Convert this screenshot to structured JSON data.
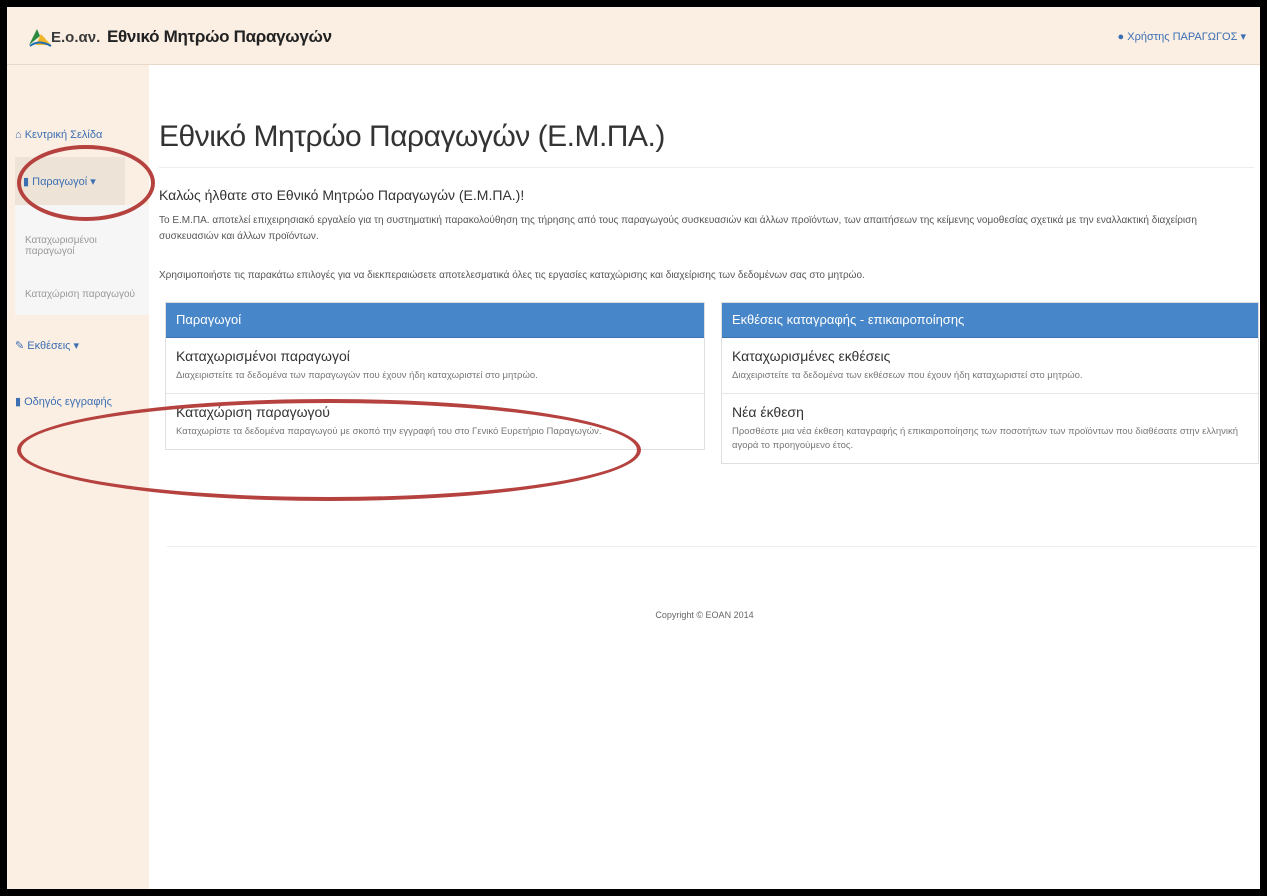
{
  "navbar": {
    "brand_short": "Ε.ο.αν.",
    "brand_title": "Εθνικό Μητρώο Παραγωγών",
    "user_label": "Χρήστης ΠΑΡΑΓΩΓΟΣ",
    "user_caret": "▾",
    "user_icon": "user-icon"
  },
  "sidebar": {
    "items": [
      {
        "icon": "home-icon",
        "glyph": "⌂",
        "label": "Κεντρική Σελίδα"
      },
      {
        "icon": "book-icon",
        "glyph": "▮",
        "label": "Παραγωγοί",
        "caret": "▾"
      },
      {
        "label": "Καταχωρισμένοι παραγωγοί"
      },
      {
        "label": "Καταχώριση παραγωγού"
      },
      {
        "icon": "pencil-icon",
        "glyph": "✎",
        "label": "Εκθέσεις",
        "caret": "▾"
      },
      {
        "icon": "book-icon",
        "glyph": "▮",
        "label": "Οδηγός εγγραφής"
      }
    ]
  },
  "main": {
    "title": "Εθνικό Μητρώο Παραγωγών (Ε.Μ.ΠΑ.)",
    "welcome": "Καλώς ήλθατε στο Εθνικό Μητρώο Παραγωγών (Ε.Μ.ΠΑ.)!",
    "intro": "Το Ε.Μ.ΠΑ. αποτελεί επιχειρησιακό εργαλείο για τη συστηματική παρακολούθηση της τήρησης από τους παραγωγούς συσκευασιών και άλλων προϊόντων, των απαιτήσεων της κείμενης νομοθεσίας σχετικά με την εναλλακτική διαχείριση συσκευασιών και άλλων προϊόντων.",
    "instructions": "Χρησιμοποιήστε τις παρακάτω επιλογές για να διεκπεραιώσετε αποτελεσματικά όλες τις εργασίες καταχώρισης και διαχείρισης των δεδομένων σας στο μητρώο.",
    "panels": [
      {
        "heading": "Παραγωγοί",
        "rows": [
          {
            "title": "Καταχωρισμένοι παραγωγοί",
            "desc": "Διαχειριστείτε τα δεδομένα των παραγωγών που έχουν ήδη καταχωριστεί στο μητρώο."
          },
          {
            "title": "Καταχώριση παραγωγού",
            "desc": "Καταχωρίστε τα δεδομένα παραγωγού με σκοπό την εγγραφή του στο Γενικό Ευρετήριο Παραγωγών."
          }
        ]
      },
      {
        "heading": "Εκθέσεις καταγραφής - επικαιροποίησης",
        "rows": [
          {
            "title": "Καταχωρισμένες εκθέσεις",
            "desc": "Διαχειριστείτε τα δεδομένα των εκθέσεων που έχουν ήδη καταχωριστεί στο μητρώο."
          },
          {
            "title": "Νέα έκθεση",
            "desc": "Προσθέστε μια νέα έκθεση καταγραφής ή επικαιροποίησης των ποσοτήτων των προϊόντων που διαθέσατε στην ελληνική αγορά το προηγούμενο έτος."
          }
        ]
      }
    ],
    "copyright": "Copyright © EOAN 2014"
  },
  "colors": {
    "navbar_bg": "#fbeee3",
    "panel_header": "#4786c9",
    "link": "#3b6fb2",
    "annotation": "#b5423e"
  }
}
